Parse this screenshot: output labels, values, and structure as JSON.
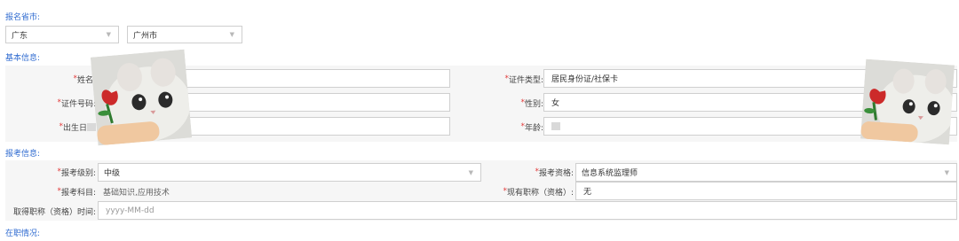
{
  "province_city": {
    "title": "报名省市:",
    "province": "广东",
    "city": "广州市"
  },
  "basic_info": {
    "title": "基本信息:",
    "name_label": "姓名:",
    "id_type_label": "证件类型:",
    "id_type_value": "居民身份证/社保卡",
    "id_number_label": "证件号码:",
    "gender_label": "性别:",
    "gender_value": "女",
    "birth_label": "出生日",
    "age_label": "年龄:"
  },
  "exam_info": {
    "title": "报考信息:",
    "level_label": "报考级别:",
    "level_value": "中级",
    "qualification_label": "报考资格:",
    "qualification_value": "信息系统监理师",
    "subject_label": "报考科目:",
    "subject_value": "基础知识,应用技术",
    "title_current_label": "现有职称（资格）:",
    "title_current_value": "无",
    "title_date_label": "取得职称（资格）时间:",
    "title_date_placeholder": "yyyy-MM-dd"
  },
  "employment": {
    "title": "在职情况:"
  },
  "required_mark": "*"
}
